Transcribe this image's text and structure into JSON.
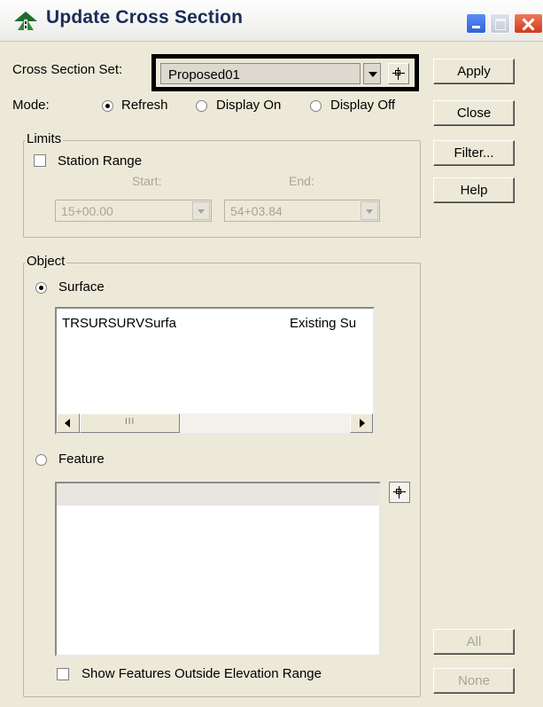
{
  "window": {
    "title": "Update Cross Section"
  },
  "cross_section_set": {
    "label": "Cross Section Set:",
    "value": "Proposed01"
  },
  "mode": {
    "label": "Mode:",
    "options": [
      "Refresh",
      "Display On",
      "Display Off"
    ],
    "selected": "Refresh"
  },
  "limits": {
    "caption": "Limits",
    "station_range_label": "Station Range",
    "station_range_checked": false,
    "start_label": "Start:",
    "end_label": "End:",
    "start_value": "15+00.00",
    "end_value": "54+03.84"
  },
  "object": {
    "caption": "Object",
    "surface_label": "Surface",
    "surface_selected": true,
    "surface_rows": [
      {
        "name": "TRSURSURVSurfa",
        "description": "Existing Su"
      }
    ],
    "scroll_thumb_label": "III",
    "feature_label": "Feature",
    "feature_selected": false,
    "show_outside_label": "Show Features Outside Elevation Range",
    "show_outside_checked": false
  },
  "buttons": {
    "apply": "Apply",
    "close": "Close",
    "filter": "Filter...",
    "help": "Help",
    "all": "All",
    "none": "None"
  },
  "colors": {
    "dialog_bg": "#ece9d8",
    "title_text": "#1a2c56",
    "highlight_border": "#000000",
    "close_button": "#cf3a17"
  }
}
